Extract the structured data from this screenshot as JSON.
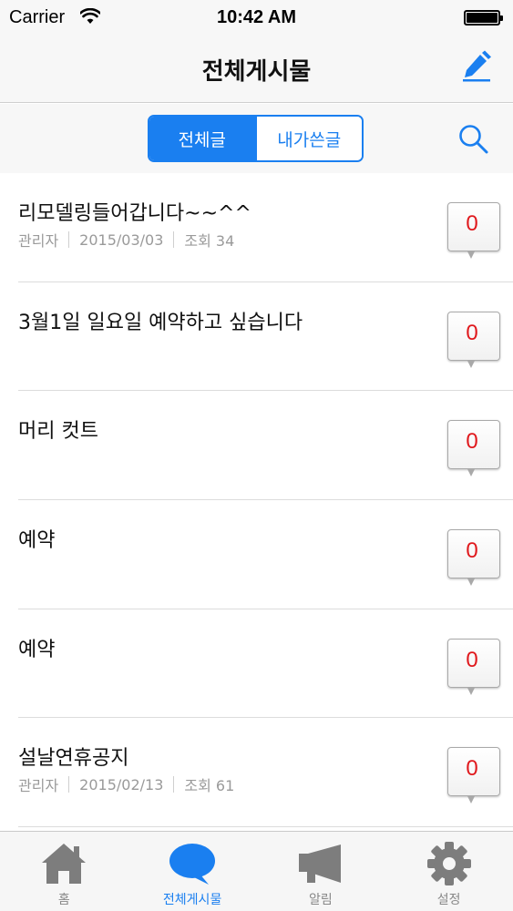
{
  "status_bar": {
    "carrier": "Carrier",
    "time": "10:42 AM"
  },
  "nav": {
    "title": "전체게시물",
    "compose_icon": "pencil-icon"
  },
  "segment": {
    "tabs": [
      {
        "label": "전체글",
        "selected": true
      },
      {
        "label": "내가쓴글",
        "selected": false
      }
    ],
    "search_icon": "search-icon"
  },
  "posts": [
    {
      "title": "리모델링들어갑니다~~^^",
      "author": "관리자",
      "date": "2015/03/03",
      "views": "조회 34",
      "comments": "0"
    },
    {
      "title": "3월1일 일요일 예약하고 싶습니다",
      "author": "",
      "date": "",
      "views": "",
      "comments": "0"
    },
    {
      "title": "머리 컷트",
      "author": "",
      "date": "",
      "views": "",
      "comments": "0"
    },
    {
      "title": "예약",
      "author": "",
      "date": "",
      "views": "",
      "comments": "0"
    },
    {
      "title": "예약",
      "author": "",
      "date": "",
      "views": "",
      "comments": "0"
    },
    {
      "title": "설날연휴공지",
      "author": "관리자",
      "date": "2015/02/13",
      "views": "조회 61",
      "comments": "0"
    }
  ],
  "tab_bar": {
    "tabs": [
      {
        "label": "홈",
        "icon": "home-icon",
        "active": false
      },
      {
        "label": "전체게시물",
        "icon": "speech-bubble-icon",
        "active": true
      },
      {
        "label": "알림",
        "icon": "megaphone-icon",
        "active": false
      },
      {
        "label": "설정",
        "icon": "gear-icon",
        "active": false
      }
    ]
  },
  "colors": {
    "accent": "#1a7ff0",
    "comment_count": "#e0191d",
    "inactive_icon": "#7d7d7d"
  }
}
